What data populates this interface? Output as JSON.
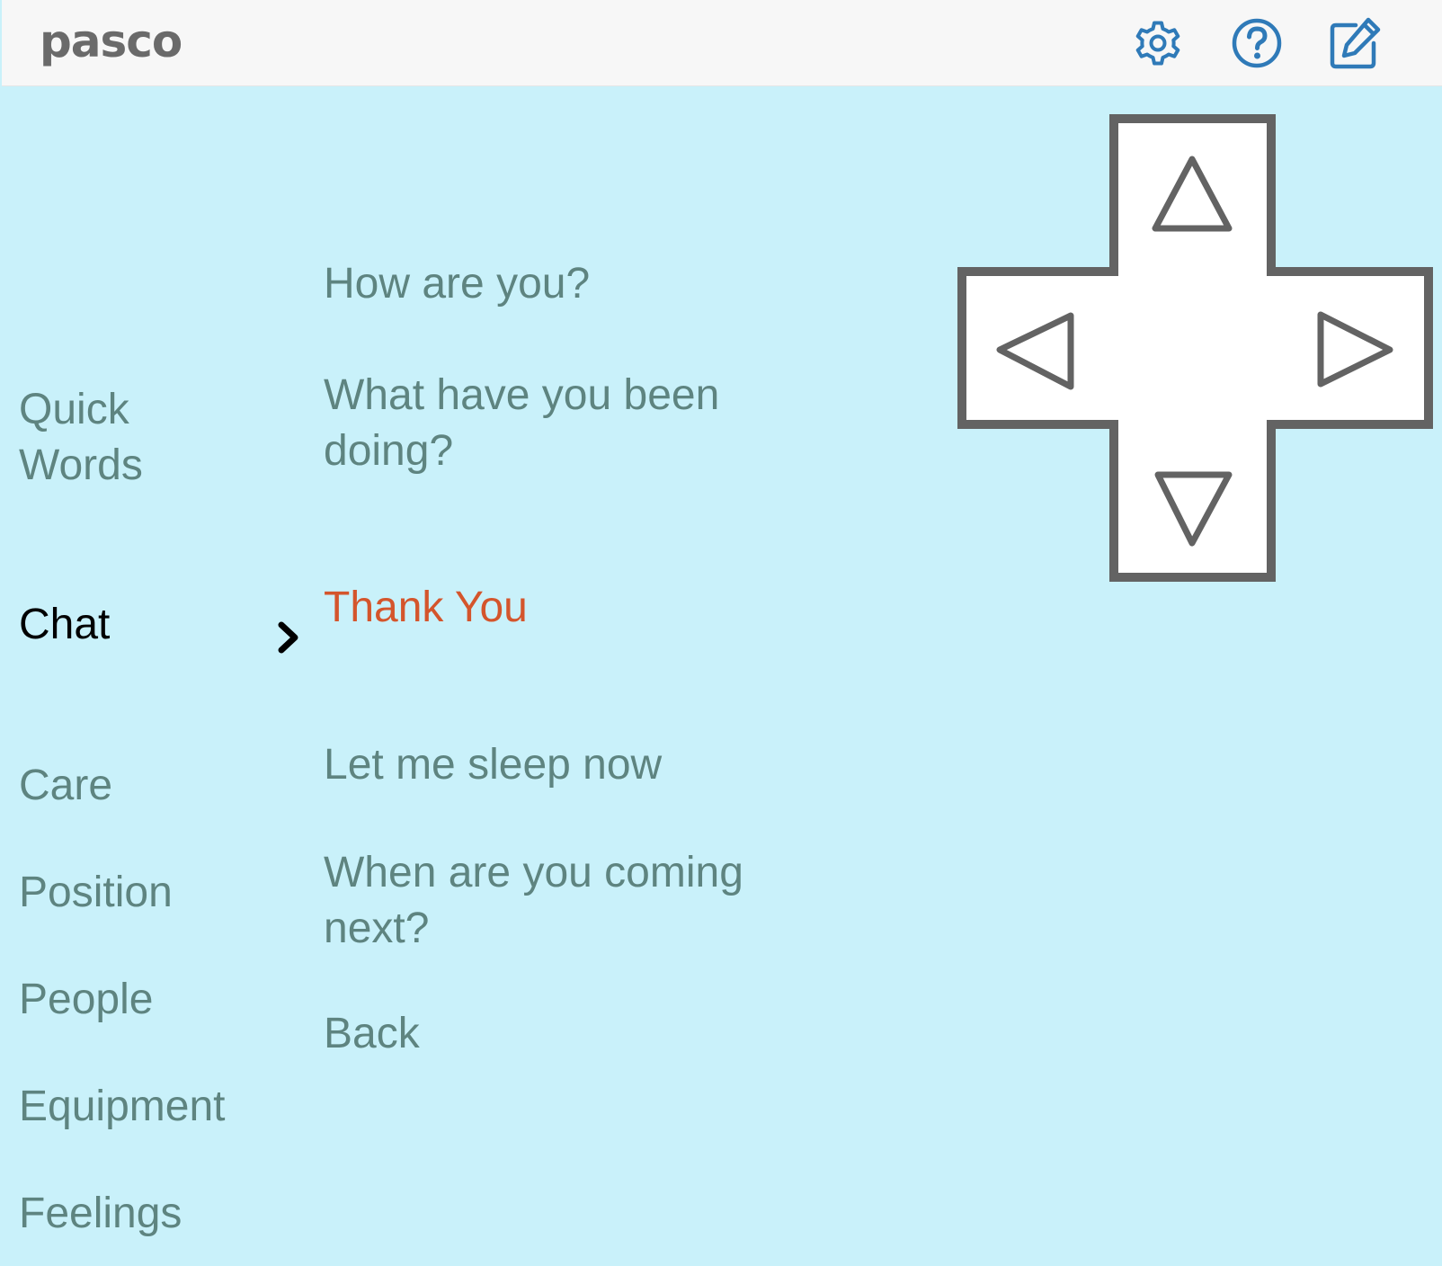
{
  "header": {
    "brand": "pasco",
    "icons": [
      "gear-icon",
      "help-icon",
      "edit-icon"
    ],
    "accent_color": "#2f7ab8"
  },
  "categories": [
    {
      "label": "Quick Words",
      "active": false
    },
    {
      "label": "Chat",
      "active": true
    },
    {
      "label": "Care",
      "active": false
    },
    {
      "label": "Position",
      "active": false
    },
    {
      "label": "People",
      "active": false
    },
    {
      "label": "Equipment",
      "active": false
    },
    {
      "label": "Feelings",
      "active": false
    }
  ],
  "items": [
    {
      "label": "How are you?",
      "active": false
    },
    {
      "label": "What have you been doing?",
      "active": false
    },
    {
      "label": "Thank You",
      "active": true
    },
    {
      "label": "Let me sleep now",
      "active": false
    },
    {
      "label": "When are you coming next?",
      "active": false
    },
    {
      "label": "Back",
      "active": false
    }
  ],
  "colors": {
    "background": "#c9f1fa",
    "text": "#5e8480",
    "active_category": "#000000",
    "active_item": "#d4552c",
    "dpad_stroke": "#636363",
    "dpad_fill": "#ffffff"
  },
  "dpad": {
    "icons": [
      "arrow-up-icon",
      "arrow-left-icon",
      "arrow-right-icon",
      "arrow-down-icon"
    ]
  }
}
